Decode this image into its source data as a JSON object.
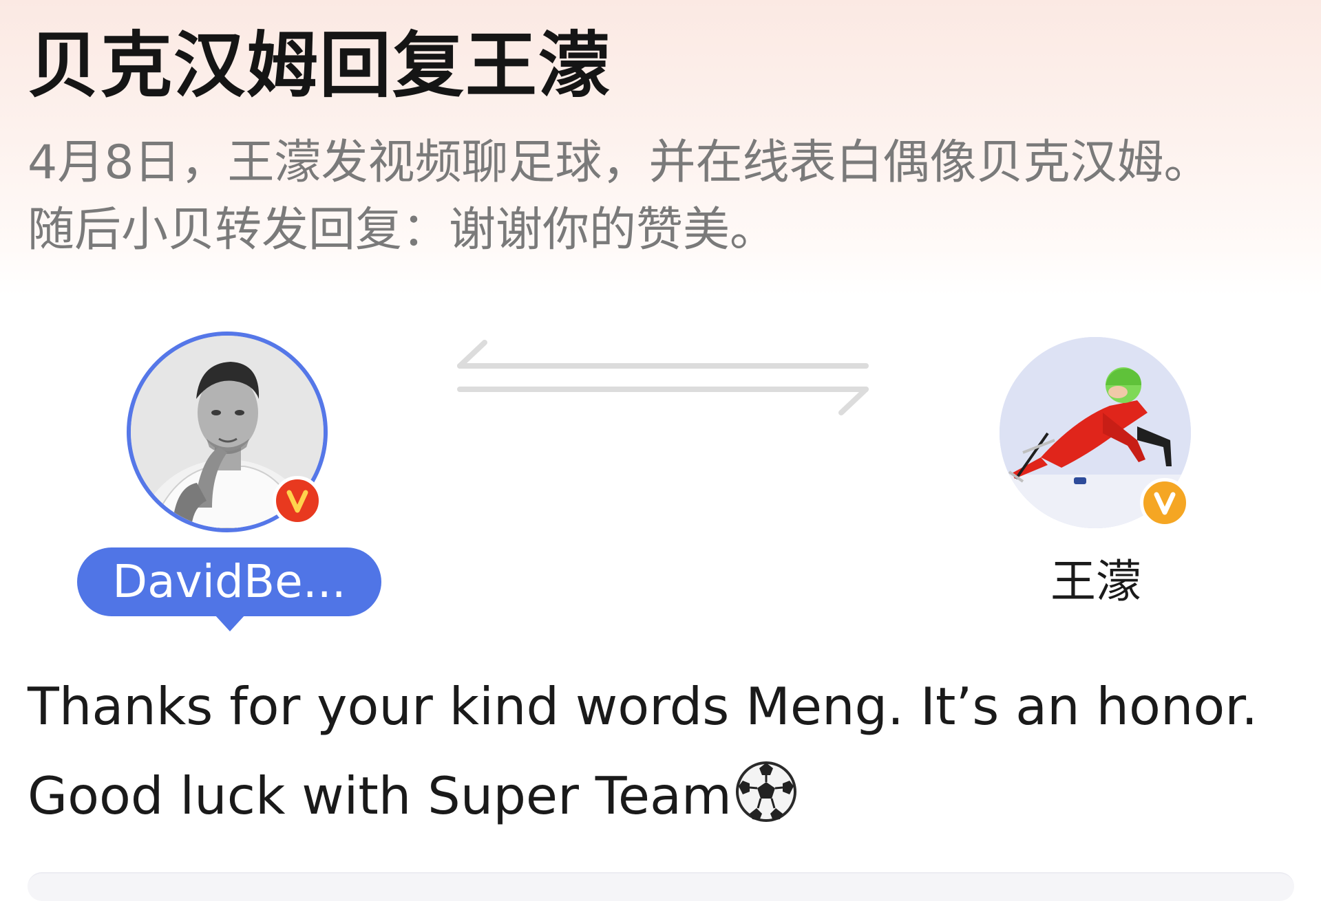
{
  "headline": "贝克汉姆回复王濛",
  "summary": {
    "line1": "4月8日，王濛发视频聊足球，并在线表白偶像贝克汉姆。",
    "line2": "随后小贝转发回复：谢谢你的赞美。"
  },
  "interaction": {
    "from": {
      "name": "DavidBe...",
      "verified_badge": "V",
      "badge_color": "#e8391f",
      "ring_color": "#5577e8"
    },
    "to": {
      "name": "王濛",
      "verified_badge": "V",
      "badge_color": "#f5a623"
    },
    "exchange_icon": "two-way-arrows-icon"
  },
  "quote": {
    "line1": "Thanks for your kind words Meng. It’s an honor.",
    "line2": "Good luck with Super Team",
    "emoji": "soccer-ball-icon"
  },
  "colors": {
    "accent_blue": "#5075e6",
    "headline_text": "#151515",
    "summary_text": "#7a7a7a",
    "header_gradient_top": "#fbe9e3"
  }
}
